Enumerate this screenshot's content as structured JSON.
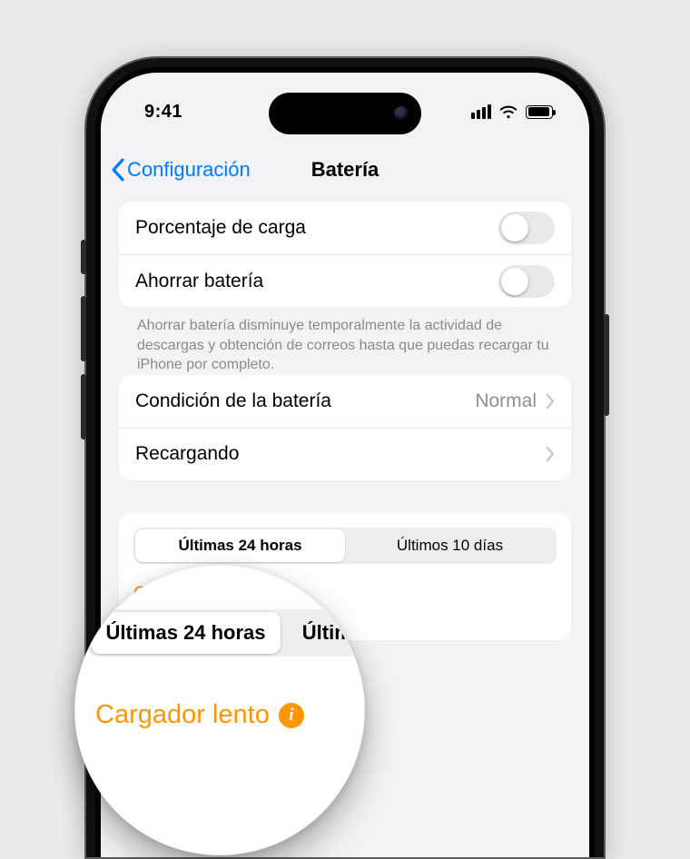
{
  "status": {
    "time": "9:41"
  },
  "nav": {
    "back": "Configuración",
    "title": "Batería"
  },
  "section1": {
    "row_percentage": "Porcentaje de carga",
    "row_lowpower": "Ahorrar batería",
    "footer": "Ahorrar batería disminuye temporalmente la actividad de descargas y obtención de correos hasta que puedas recargar tu iPhone por completo."
  },
  "section2": {
    "row_health": "Condición de la batería",
    "row_health_value": "Normal",
    "row_charging": "Recargando"
  },
  "segmented": {
    "tab_24h": "Últimas 24 horas",
    "tab_10d": "Últimos 10 días"
  },
  "slow_charger": "Cargador lento",
  "info_glyph": "i"
}
